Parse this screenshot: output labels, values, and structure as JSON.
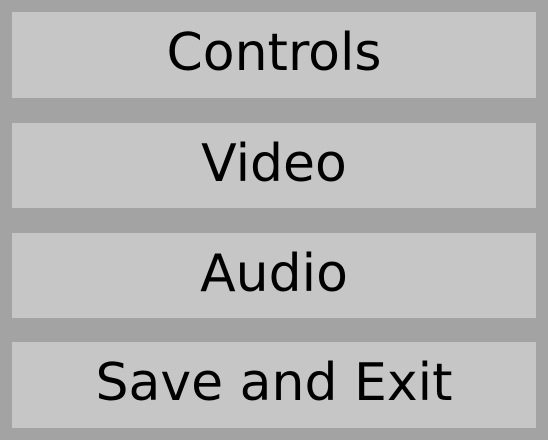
{
  "menu": {
    "items": [
      {
        "label": "Controls"
      },
      {
        "label": "Video"
      },
      {
        "label": "Audio"
      },
      {
        "label": "Save and Exit"
      }
    ]
  },
  "colors": {
    "background": "#a3a3a3",
    "button": "#c6c6c6",
    "text": "#000000"
  }
}
